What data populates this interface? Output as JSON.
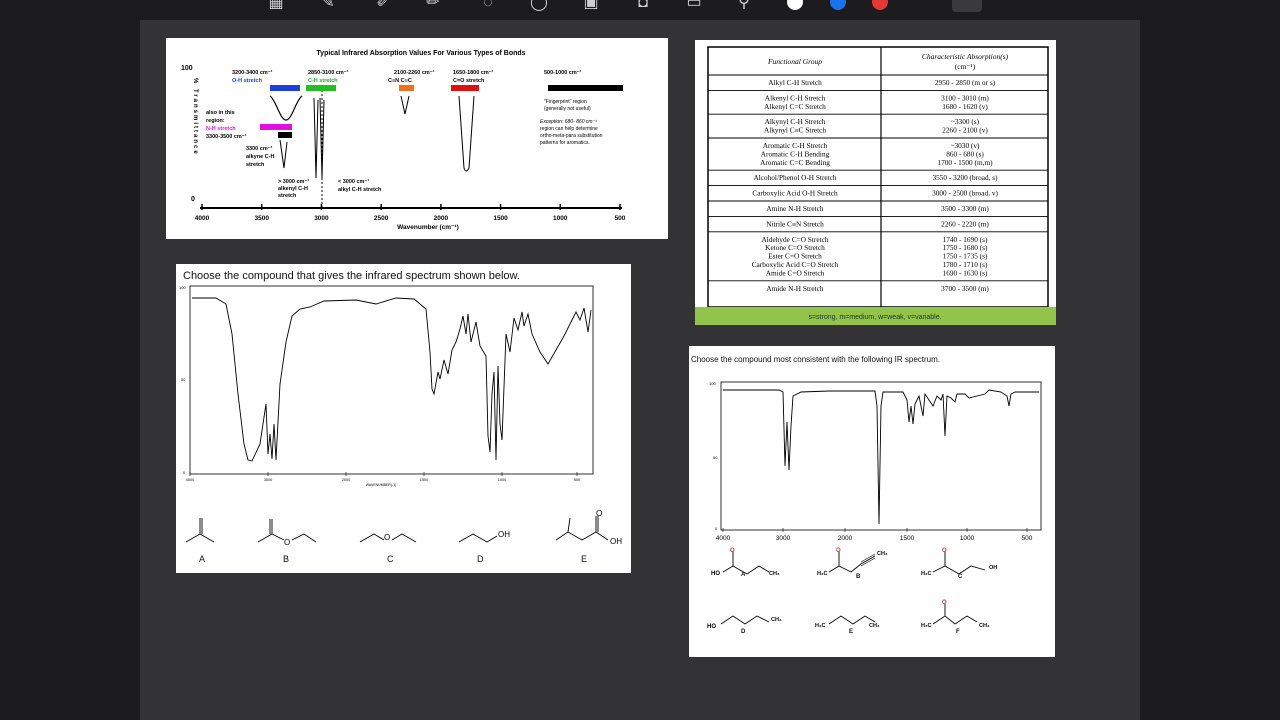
{
  "toolbar": {
    "tools": [
      "grid-icon",
      "pen-icon",
      "eraser-icon",
      "highlighter-icon",
      "lasso-icon",
      "shapes-icon",
      "image-icon",
      "camera-icon",
      "text-icon",
      "link-icon"
    ],
    "colors": [
      "#ffffff",
      "#1a73e8",
      "#e53935"
    ]
  },
  "ir_chart": {
    "title": "Typical Infrared Absorption Values For Various Types of Bonds",
    "y_top": "100",
    "y_bottom": "0",
    "y_label": "% Transmittance",
    "x_label": "Wavenumber (cm⁻¹)",
    "x_ticks": [
      "4000",
      "3500",
      "3000",
      "2500",
      "2000",
      "1500",
      "1000",
      "500"
    ],
    "oh_range": "3200-3400 cm⁻¹",
    "oh_label": "O-H stretch",
    "ch_range": "2850-3100 cm⁻¹",
    "ch_label": "C-H stretch",
    "triple_range": "2100-2260 cm⁻¹",
    "triple_label": "C≡N  C≡C",
    "co_range": "1650-1800 cm⁻¹",
    "co_label": "C=O stretch",
    "fp_range": "500-1000 cm⁻¹",
    "fp_note1": "\"Fingerprint\" region",
    "fp_note2": "(generally not useful)",
    "exc1": "Exception: 680- 860 cm⁻¹",
    "exc2": "region can help determine",
    "exc3": "ortho-meta-para substitution",
    "exc4": "patterns for aromatics.",
    "also1": "also in this",
    "also2": "region:",
    "nh_label": "N-H stretch",
    "nh_range": "3300-3500 cm⁻¹",
    "alkyne1": "3300 cm⁻¹",
    "alkyne2": "alkyne C-H",
    "alkyne3": "stretch",
    "alkenyl1": "> 3000 cm⁻¹",
    "alkenyl2": "alkenyl C-H",
    "alkenyl3": "stretch",
    "alkyl1": "< 3000 cm⁻¹",
    "alkyl2": "alkyl C-H stretch"
  },
  "table": {
    "h1": "Functional Group",
    "h2": "Characteristic Absorption(s)",
    "h2b": "(cm⁻¹)",
    "rows": [
      {
        "g": [
          "Alkyl C-H Stretch"
        ],
        "a": [
          "2950 - 2850 (m or s)"
        ]
      },
      {
        "g": [
          "Alkenyl C-H Stretch",
          "Alkenyl C=C Stretch"
        ],
        "a": [
          "3100 - 3010 (m)",
          "1680 - 1620 (v)"
        ]
      },
      {
        "g": [
          "Alkynyl C-H Stretch",
          "Alkynyl C≡C Stretch"
        ],
        "a": [
          "~3300 (s)",
          "2260 - 2100 (v)"
        ]
      },
      {
        "g": [
          "Aromatic C-H Stretch",
          "Aromatic C-H Bending",
          "Aromatic C=C Bending"
        ],
        "a": [
          "~3030 (v)",
          "860 - 680 (s)",
          "1700 - 1500 (m,m)"
        ]
      },
      {
        "g": [
          "Alcohol/Phenol O-H Stretch"
        ],
        "a": [
          "3550 - 3200 (broad, s)"
        ]
      },
      {
        "g": [
          "Carboxylic Acid O-H Stretch"
        ],
        "a": [
          "3000 - 2500 (broad, v)"
        ]
      },
      {
        "g": [
          "Amine N-H Stretch"
        ],
        "a": [
          "3500 - 3300 (m)"
        ]
      },
      {
        "g": [
          "Nitrile C≡N Stretch"
        ],
        "a": [
          "2260 - 2220 (m)"
        ]
      },
      {
        "g": [
          "Aldehyde C=O Stretch",
          "Ketone C=O Stretch",
          "Ester C=O Stretch",
          "Carboxylic Acid C=O Stretch",
          "Amide C=O Stretch"
        ],
        "a": [
          "1740 - 1690 (s)",
          "1750 - 1680 (s)",
          "1750 - 1735 (s)",
          "1780 - 1710 (s)",
          "1690 - 1630 (s)"
        ]
      },
      {
        "g": [
          "Amide N-H Stretch"
        ],
        "a": [
          "3700 - 3500 (m)"
        ]
      }
    ],
    "footer": "s=strong, m=medium, w=weak, v=variable."
  },
  "q1": {
    "prompt": "Choose the compound that gives the infrared spectrum shown below.",
    "y_top": "100",
    "y_mid": "50",
    "y_bottom": "0",
    "x_label": "WAVENUMBER(-1)",
    "x_ticks": [
      "4000",
      "3000",
      "2000",
      "1500",
      "1000",
      "500"
    ],
    "options": [
      "A",
      "B",
      "C",
      "D",
      "E"
    ],
    "oh": "OH"
  },
  "q2": {
    "prompt": "Choose the compound most consistent with the following IR spectrum.",
    "y_top": "100",
    "y_mid": "50",
    "y_bottom": "0",
    "x_ticks": [
      "4000",
      "3000",
      "2000",
      "1500",
      "1000",
      "500"
    ],
    "options": [
      "A",
      "B",
      "C",
      "D",
      "E",
      "F"
    ],
    "ho": "HO",
    "oh": "OH",
    "ch3": "CH₃",
    "h3c": "H₃C"
  }
}
